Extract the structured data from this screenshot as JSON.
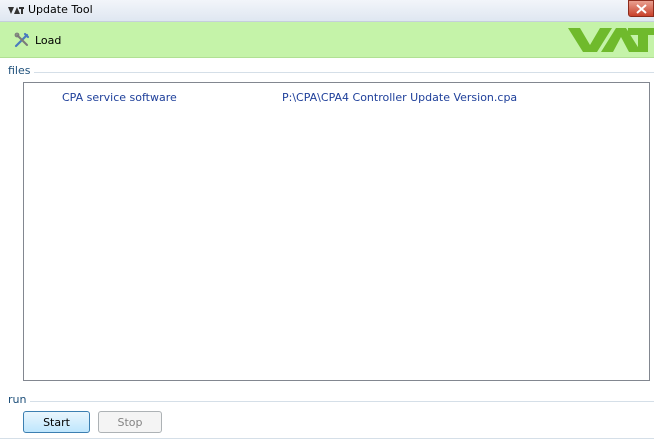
{
  "window": {
    "title": "Update Tool"
  },
  "toolbar": {
    "load_label": "Load",
    "logo_text": "VAT",
    "background_color": "#c5f3a9"
  },
  "files": {
    "group_label": "files",
    "items": [
      {
        "name": "CPA service software",
        "path": "P:\\CPA\\CPA4 Controller Update Version.cpa"
      }
    ]
  },
  "run": {
    "group_label": "run",
    "start_label": "Start",
    "stop_label": "Stop",
    "stop_enabled": false
  },
  "icons": {
    "app": "vat-app-icon",
    "load": "load-tools-icon",
    "close": "close-icon"
  },
  "colors": {
    "accent_green": "#c5f3a9",
    "logo_green": "#6fba2c",
    "link_blue": "#1e3f9a",
    "label_blue": "#1d4f7a"
  }
}
